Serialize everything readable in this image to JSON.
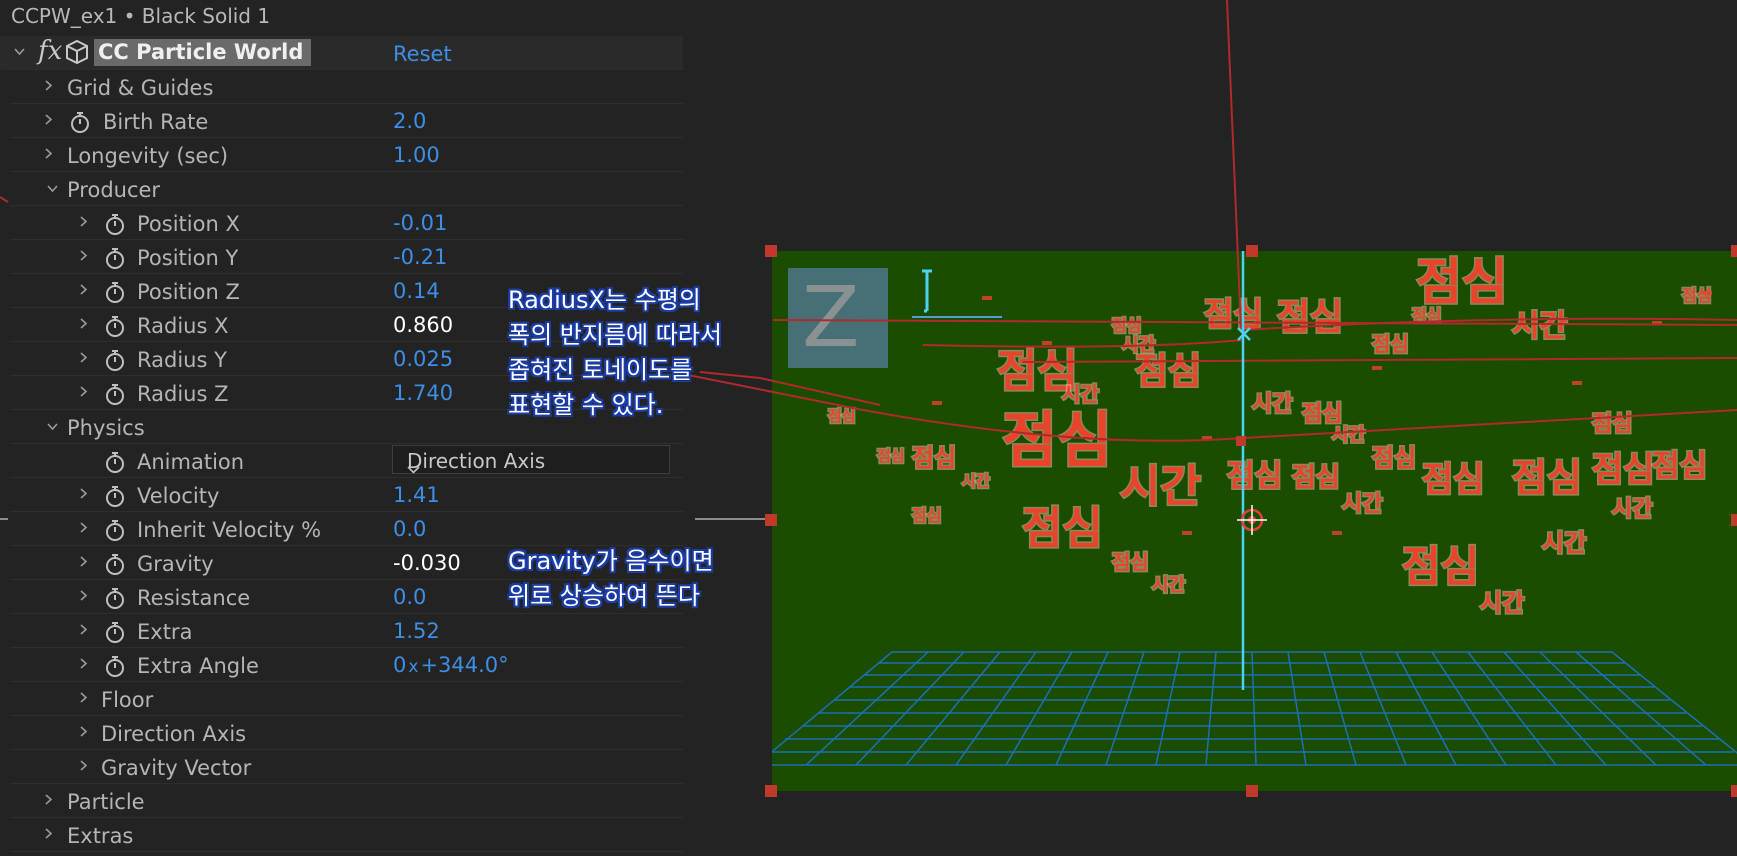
{
  "panel": {
    "title": "CCPW_ex1 • Black Solid 1",
    "effect_name": "CC Particle World",
    "fx_glyph": "fx",
    "reset_label": "Reset"
  },
  "rows": {
    "grid_guides": {
      "label": "Grid & Guides"
    },
    "birth_rate": {
      "label": "Birth Rate",
      "value": "2.0"
    },
    "longevity": {
      "label": "Longevity (sec)",
      "value": "1.00"
    },
    "producer": {
      "label": "Producer"
    },
    "position_x": {
      "label": "Position X",
      "value": "-0.01"
    },
    "position_y": {
      "label": "Position Y",
      "value": "-0.21"
    },
    "position_z": {
      "label": "Position Z",
      "value": "0.14"
    },
    "radius_x": {
      "label": "Radius X",
      "value": "0.860"
    },
    "radius_y": {
      "label": "Radius Y",
      "value": "0.025"
    },
    "radius_z": {
      "label": "Radius Z",
      "value": "1.740"
    },
    "physics": {
      "label": "Physics"
    },
    "animation": {
      "label": "Animation",
      "value": "Direction Axis"
    },
    "velocity": {
      "label": "Velocity",
      "value": "1.41"
    },
    "inherit_velocity": {
      "label": "Inherit Velocity %",
      "value": "0.0"
    },
    "gravity": {
      "label": "Gravity",
      "value": "-0.030"
    },
    "resistance": {
      "label": "Resistance",
      "value": "0.0"
    },
    "extra": {
      "label": "Extra",
      "value": "1.52"
    },
    "extra_angle": {
      "label": "Extra Angle",
      "value_rev": "0",
      "value_x": "x",
      "value_deg": "+344.0°"
    },
    "floor": {
      "label": "Floor"
    },
    "direction_axis": {
      "label": "Direction Axis"
    },
    "gravity_vector": {
      "label": "Gravity Vector"
    },
    "particle": {
      "label": "Particle"
    },
    "extras": {
      "label": "Extras"
    }
  },
  "annotations": {
    "radius_note": [
      "RadiusX는 수평의",
      "폭의 반지름에 따라서",
      "좁혀진 토네이도를",
      "표현할 수 있다."
    ],
    "gravity_note": [
      "Gravity가 음수이면",
      "위로 상승하여 뜬다"
    ]
  },
  "viewer": {
    "axis_label": "Z",
    "particle_word_1": "점심",
    "particle_word_2": "시간",
    "colors": {
      "comp_background": "#1a4d00",
      "particle_text": "#e8442a",
      "grid": "#1e6fb5",
      "guide_line": "#b02a2a",
      "axis_line": "#4fd2f0",
      "handle": "#c0392b"
    }
  },
  "icons": [
    "chevron-right-icon",
    "chevron-down-icon",
    "stopwatch-icon",
    "fx-icon",
    "cube-icon",
    "dropdown-chevron-icon",
    "anchor-point-icon"
  ]
}
